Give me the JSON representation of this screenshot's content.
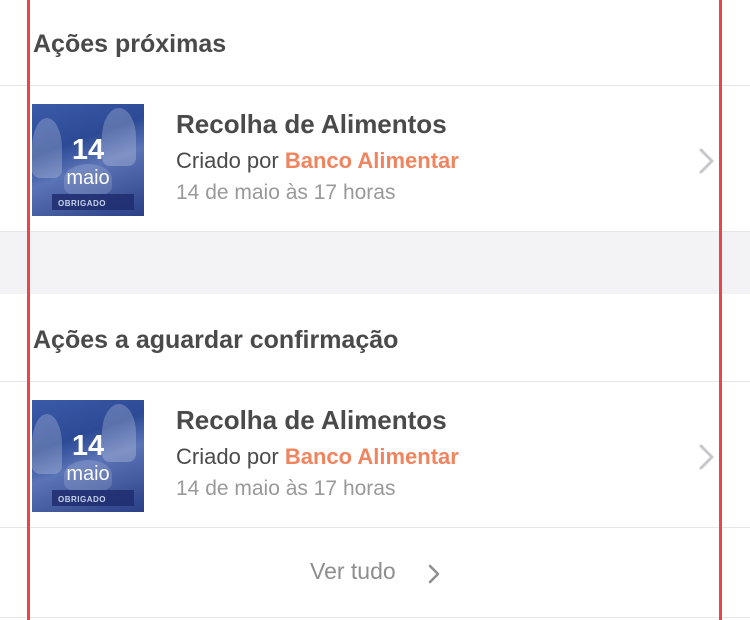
{
  "sections": [
    {
      "title": "Ações próximas",
      "item": {
        "thumb_day": "14",
        "thumb_month": "maio",
        "thumb_banner": "OBRIGADO",
        "title": "Recolha de Alimentos",
        "created_by_prefix": "Criado por",
        "organization": "Banco Alimentar",
        "date_text": "14 de maio às 17 horas"
      }
    },
    {
      "title": "Ações a aguardar confirmação",
      "item": {
        "thumb_day": "14",
        "thumb_month": "maio",
        "thumb_banner": "OBRIGADO",
        "title": "Recolha de Alimentos",
        "created_by_prefix": "Criado por",
        "organization": "Banco Alimentar",
        "date_text": "14 de maio às 17 horas"
      }
    }
  ],
  "see_all_label": "Ver tudo",
  "icons": {
    "row_chevron": "chevron-right-icon",
    "see_all_chevron": "chevron-right-icon"
  },
  "colors": {
    "accent_orange": "#f0845f",
    "guide_line_red": "#e8454d",
    "title_text": "#4a4a4a",
    "muted_text": "#999999"
  }
}
